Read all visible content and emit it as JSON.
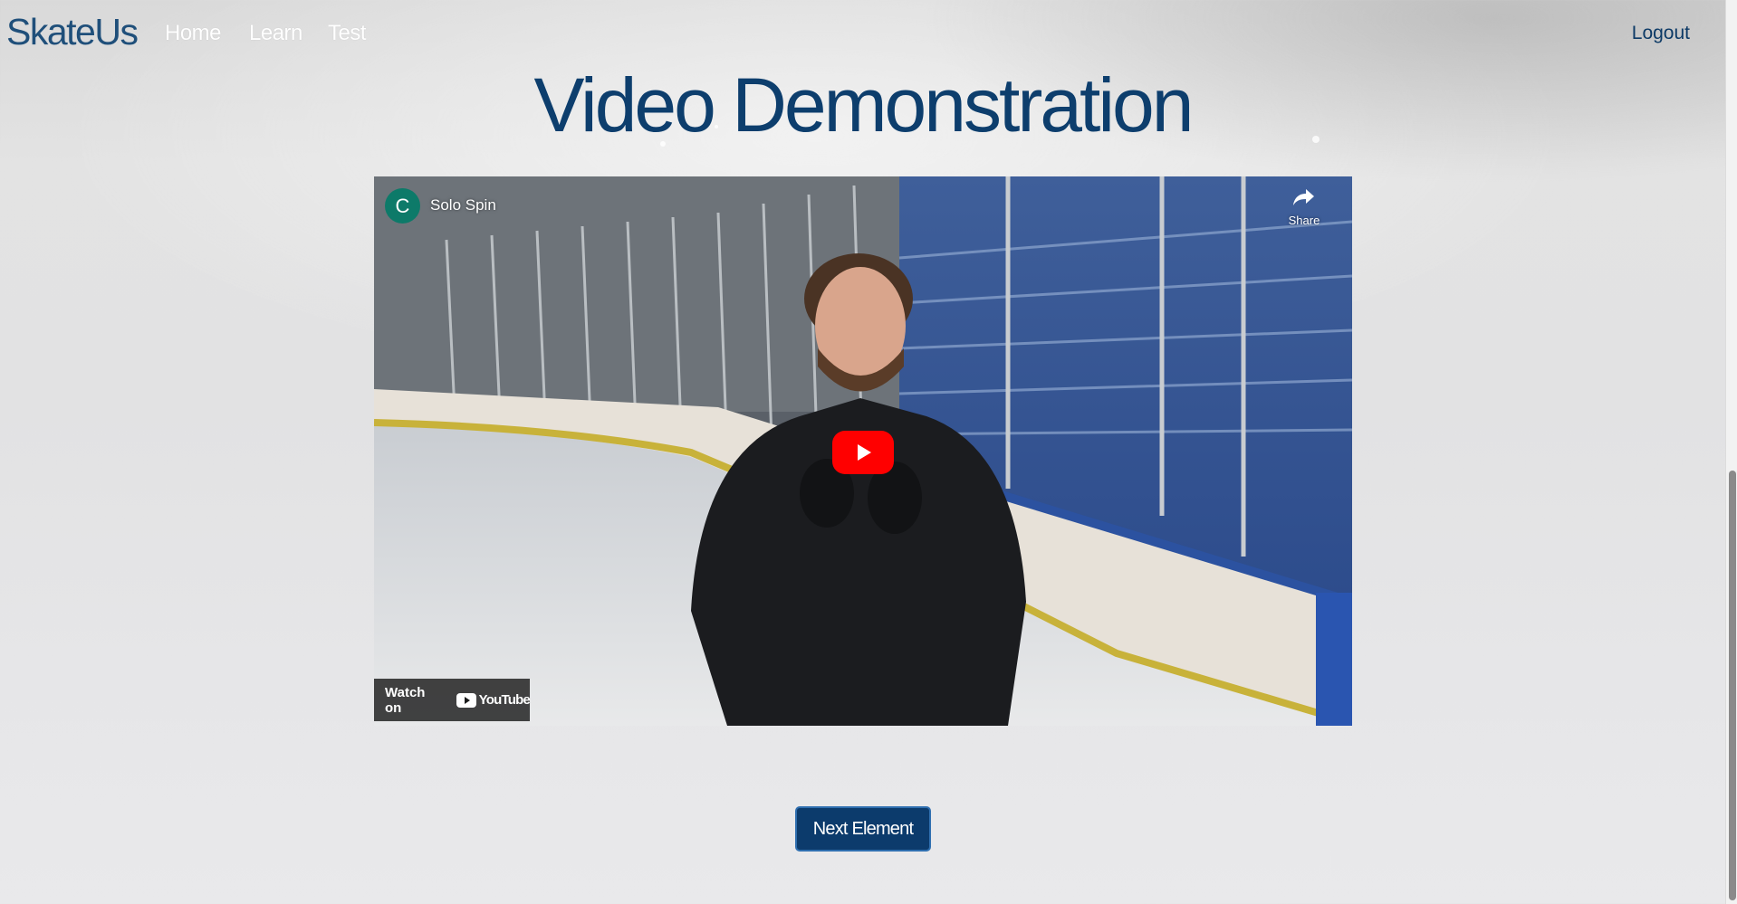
{
  "nav": {
    "brand": "SkateUs",
    "links": [
      "Home",
      "Learn",
      "Test"
    ],
    "logout": "Logout"
  },
  "page": {
    "title": "Video Demonstration"
  },
  "video": {
    "channel_initial": "C",
    "title": "Solo Spin",
    "share_label": "Share",
    "watch_on_label": "Watch on",
    "youtube_label": "YouTube"
  },
  "actions": {
    "next_label": "Next Element"
  },
  "colors": {
    "brand": "#1f4f7a",
    "title": "#0d3e6d",
    "button_bg": "#0c3b6c",
    "youtube_red": "#ff0000",
    "channel_avatar": "#0d7a69"
  }
}
